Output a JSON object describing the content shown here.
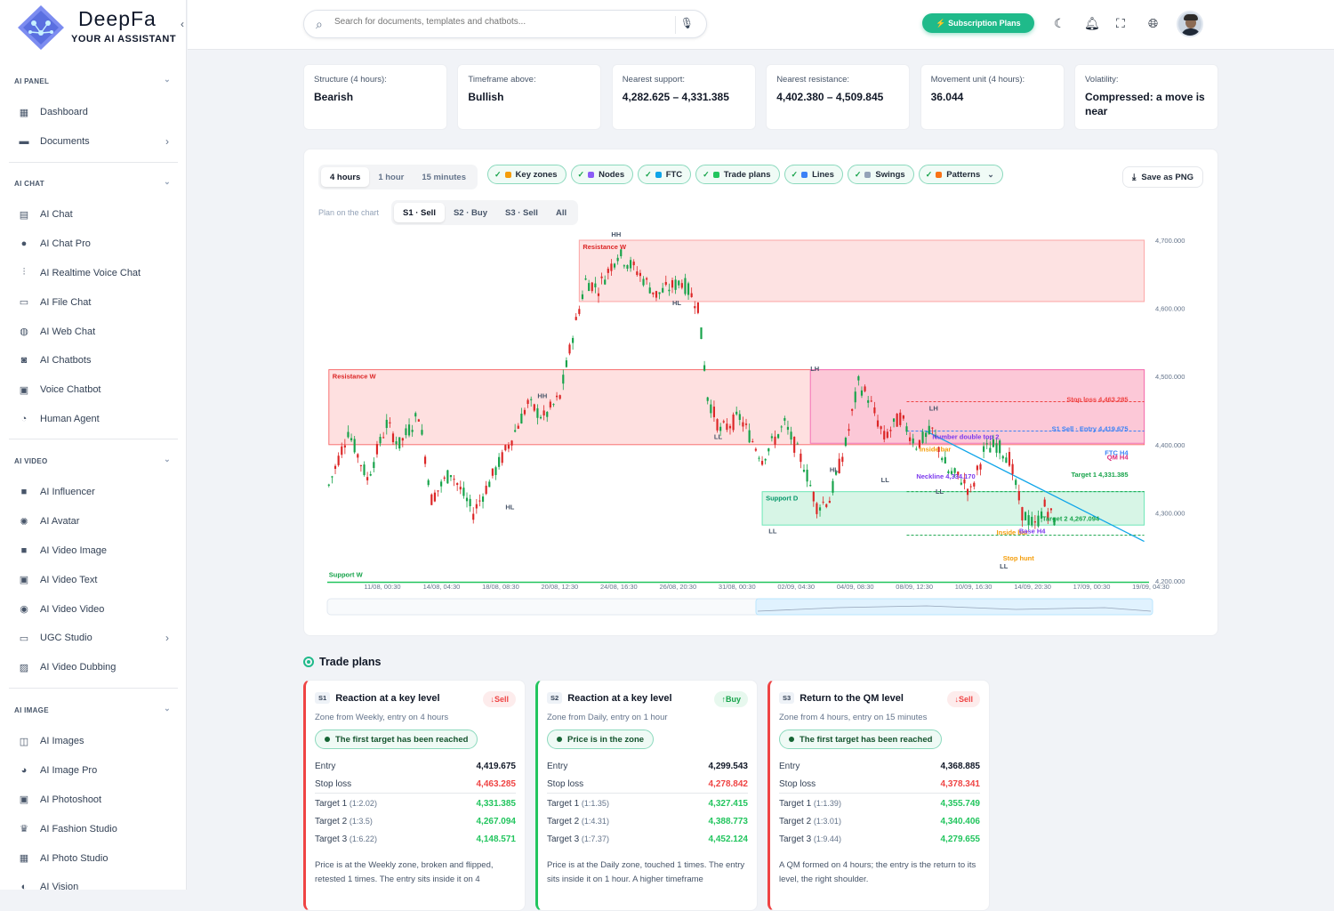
{
  "brand": {
    "name": "DeepFa",
    "tagline": "YOUR AI ASSISTANT"
  },
  "sidebar": {
    "sections": [
      {
        "title": "AI PANEL",
        "items": [
          {
            "label": "Dashboard",
            "icon": "dashboard-icon"
          },
          {
            "label": "Documents",
            "icon": "folder-icon",
            "arrow": true
          }
        ]
      },
      {
        "title": "AI CHAT",
        "items": [
          {
            "label": "AI Chat",
            "icon": "chat-icon"
          },
          {
            "label": "AI Chat Pro",
            "icon": "chat-pro-icon"
          },
          {
            "label": "AI Realtime Voice Chat",
            "icon": "waveform-icon"
          },
          {
            "label": "AI File Chat",
            "icon": "file-chat-icon"
          },
          {
            "label": "AI Web Chat",
            "icon": "globe-icon"
          },
          {
            "label": "AI Chatbots",
            "icon": "robot-icon"
          },
          {
            "label": "Voice Chatbot",
            "icon": "voice-bot-icon"
          },
          {
            "label": "Human Agent",
            "icon": "headset-icon"
          }
        ]
      },
      {
        "title": "AI VIDEO",
        "items": [
          {
            "label": "AI Influencer",
            "icon": "camera-icon"
          },
          {
            "label": "AI Avatar",
            "icon": "avatar-icon"
          },
          {
            "label": "AI Video Image",
            "icon": "video-image-icon"
          },
          {
            "label": "AI Video Text",
            "icon": "video-text-icon"
          },
          {
            "label": "AI Video Video",
            "icon": "video-reel-icon"
          },
          {
            "label": "UGC Studio",
            "icon": "studio-icon",
            "arrow": true
          },
          {
            "label": "AI Video Dubbing",
            "icon": "dubbing-icon"
          }
        ]
      },
      {
        "title": "AI IMAGE",
        "items": [
          {
            "label": "AI Images",
            "icon": "image-scan-icon"
          },
          {
            "label": "AI Image Pro",
            "icon": "image-pro-icon"
          },
          {
            "label": "AI Photoshoot",
            "icon": "photo-icon"
          },
          {
            "label": "AI Fashion Studio",
            "icon": "shirt-icon"
          },
          {
            "label": "AI Photo Studio",
            "icon": "photo-studio-icon"
          },
          {
            "label": "AI Vision",
            "icon": "eye-icon"
          }
        ]
      }
    ]
  },
  "topbar": {
    "search_placeholder": "Search for documents, templates and chatbots...",
    "subscription_label": "⚡ Subscription Plans"
  },
  "stats": [
    {
      "label": "Structure (4 hours):",
      "value": "Bearish"
    },
    {
      "label": "Timeframe above:",
      "value": "Bullish"
    },
    {
      "label": "Nearest support:",
      "value": "4,282.625 – 4,331.385"
    },
    {
      "label": "Nearest resistance:",
      "value": "4,402.380 – 4,509.845"
    },
    {
      "label": "Movement unit (4 hours):",
      "value": "36.044"
    },
    {
      "label": "Volatility:",
      "value": "Compressed: a move is near"
    }
  ],
  "toolbar": {
    "timeframes": [
      "4 hours",
      "1 hour",
      "15 minutes"
    ],
    "active_timeframe": 0,
    "layers": [
      {
        "label": "Key zones",
        "color": "#f59e0b"
      },
      {
        "label": "Nodes",
        "color": "#8b5cf6"
      },
      {
        "label": "FTC",
        "color": "#0ea5e9"
      },
      {
        "label": "Trade plans",
        "color": "#22c55e"
      },
      {
        "label": "Lines",
        "color": "#3b82f6"
      },
      {
        "label": "Swings",
        "color": "#94a3b8"
      },
      {
        "label": "Patterns",
        "color": "#f97316",
        "dropdown": true
      }
    ],
    "save_label": "Save as PNG",
    "plan_label": "Plan on the chart",
    "plans": [
      "S1 · Sell",
      "S2 · Buy",
      "S3 · Sell",
      "All"
    ],
    "active_plan": 0
  },
  "chart_data": {
    "type": "candlestick",
    "y_ticks": [
      "4,700.000",
      "4,600.000",
      "4,500.000",
      "4,400.000",
      "4,300.000",
      "4,200.000"
    ],
    "ylim": [
      4200,
      4700
    ],
    "x_ticks": [
      "11/08, 00:30",
      "14/08, 04:30",
      "18/08, 08:30",
      "20/08, 12:30",
      "24/08, 16:30",
      "26/08, 20:30",
      "31/08, 00:30",
      "02/09, 04:30",
      "04/09, 08:30",
      "08/09, 12:30",
      "10/09, 16:30",
      "14/09, 20:30",
      "17/09, 00:30",
      "19/09, 04:30"
    ],
    "path": [
      [
        0,
        4340
      ],
      [
        6,
        4420
      ],
      [
        12,
        4350
      ],
      [
        18,
        4430
      ],
      [
        22,
        4400
      ],
      [
        28,
        4445
      ],
      [
        32,
        4320
      ],
      [
        38,
        4360
      ],
      [
        45,
        4300
      ],
      [
        55,
        4390
      ],
      [
        62,
        4460
      ],
      [
        67,
        4440
      ],
      [
        72,
        4470
      ],
      [
        76,
        4560
      ],
      [
        80,
        4640
      ],
      [
        84,
        4630
      ],
      [
        90,
        4680
      ],
      [
        96,
        4655
      ],
      [
        102,
        4620
      ],
      [
        110,
        4640
      ],
      [
        115,
        4605
      ],
      [
        118,
        4470
      ],
      [
        122,
        4420
      ],
      [
        128,
        4440
      ],
      [
        135,
        4380
      ],
      [
        142,
        4430
      ],
      [
        148,
        4370
      ],
      [
        152,
        4310
      ],
      [
        156,
        4320
      ],
      [
        161,
        4400
      ],
      [
        165,
        4490
      ],
      [
        168,
        4470
      ],
      [
        173,
        4410
      ],
      [
        178,
        4440
      ],
      [
        183,
        4400
      ],
      [
        188,
        4420
      ],
      [
        193,
        4360
      ],
      [
        197,
        4350
      ],
      [
        200,
        4330
      ],
      [
        204,
        4390
      ],
      [
        208,
        4400
      ],
      [
        212,
        4380
      ],
      [
        216,
        4300
      ],
      [
        220,
        4280
      ],
      [
        223,
        4310
      ],
      [
        226,
        4290
      ]
    ],
    "zones": [
      {
        "label": "Resistance W",
        "y1": 4610,
        "y2": 4700,
        "x1": 78,
        "x2": 254,
        "fill": "#fde2e2",
        "stroke": "#fca5a5",
        "color": "#dc2626"
      },
      {
        "label": "Resistance W",
        "y1": 4400,
        "y2": 4510,
        "x1": 0,
        "x2": 254,
        "fill": "rgba(252,180,180,.42)",
        "stroke": "#f87171",
        "color": "#dc2626"
      },
      {
        "label": "Support D",
        "y1": 4282,
        "y2": 4331,
        "x1": 135,
        "x2": 254,
        "fill": "rgba(167,232,200,.45)",
        "stroke": "#6ee7b7",
        "color": "#059669"
      },
      {
        "label": "",
        "y1": 4402,
        "y2": 4510,
        "x1": 150,
        "x2": 254,
        "fill": "rgba(244,114,182,.22)",
        "stroke": "#f472b6",
        "color": "#db2777"
      }
    ],
    "annotations": [
      {
        "text": "HH",
        "x": 88,
        "y": 4705,
        "color": "#475569"
      },
      {
        "text": "HH",
        "x": 65,
        "y": 4468,
        "color": "#475569"
      },
      {
        "text": "HL",
        "x": 55,
        "y": 4305,
        "color": "#475569"
      },
      {
        "text": "HL",
        "x": 107,
        "y": 4605,
        "color": "#475569"
      },
      {
        "text": "LL",
        "x": 120,
        "y": 4408,
        "color": "#475569"
      },
      {
        "text": "LL",
        "x": 137,
        "y": 4270,
        "color": "#475569"
      },
      {
        "text": "LH",
        "x": 150,
        "y": 4508,
        "color": "#475569"
      },
      {
        "text": "HL",
        "x": 156,
        "y": 4360,
        "color": "#475569"
      },
      {
        "text": "LL",
        "x": 172,
        "y": 4345,
        "color": "#475569"
      },
      {
        "text": "LH",
        "x": 187,
        "y": 4450,
        "color": "#475569"
      },
      {
        "text": "LL",
        "x": 189,
        "y": 4328,
        "color": "#475569"
      },
      {
        "text": "LL",
        "x": 209,
        "y": 4218,
        "color": "#475569"
      },
      {
        "text": "Stop loss  4,463.285",
        "x": 249,
        "y": 4463,
        "color": "#ef4444",
        "anchor": "end"
      },
      {
        "text": "S1 Sell · Entry  4,419.675",
        "x": 249,
        "y": 4420,
        "color": "#3b82f6",
        "anchor": "end"
      },
      {
        "text": "FTC H4",
        "x": 249,
        "y": 4385,
        "color": "#3b82f6",
        "anchor": "end"
      },
      {
        "text": "QM H4",
        "x": 249,
        "y": 4378,
        "color": "#db2777",
        "anchor": "end"
      },
      {
        "text": "Target 1  4,331.385",
        "x": 249,
        "y": 4353,
        "color": "#16a34a",
        "anchor": "end"
      },
      {
        "text": "Target 2  4,267.094",
        "x": 240,
        "y": 4288,
        "color": "#16a34a",
        "anchor": "end"
      },
      {
        "text": "Number double top 2",
        "x": 188,
        "y": 4408,
        "color": "#7c3aed"
      },
      {
        "text": "Neckline 4,334.170",
        "x": 183,
        "y": 4350,
        "color": "#7c3aed"
      },
      {
        "text": "Inside bar",
        "x": 184,
        "y": 4390,
        "color": "#f59e0b"
      },
      {
        "text": "Inside bar",
        "x": 208,
        "y": 4268,
        "color": "#f59e0b"
      },
      {
        "text": "Base H4",
        "x": 215,
        "y": 4270,
        "color": "#7c3aed"
      },
      {
        "text": "Stop hunt",
        "x": 210,
        "y": 4230,
        "color": "#f59e0b"
      },
      {
        "text": "Support W",
        "x": 0,
        "y": 4206,
        "color": "#16a34a"
      }
    ]
  },
  "trade_plans": {
    "title": "Trade plans",
    "plans": [
      {
        "tag": "S1",
        "title": "Reaction at a key level",
        "side": "Sell",
        "side_type": "sell",
        "subtitle": "Zone from Weekly, entry on 4 hours",
        "status": "The first target has been reached",
        "entry": "4,419.675",
        "stop_loss": "4,463.285",
        "targets": [
          {
            "label": "Target 1",
            "ratio": "(1:2.02)",
            "value": "4,331.385"
          },
          {
            "label": "Target 2",
            "ratio": "(1:3.5)",
            "value": "4,267.094"
          },
          {
            "label": "Target 3",
            "ratio": "(1:6.22)",
            "value": "4,148.571"
          }
        ],
        "description": "Price is at the Weekly zone, broken and flipped, retested 1 times. The entry sits inside it on 4"
      },
      {
        "tag": "S2",
        "title": "Reaction at a key level",
        "side": "Buy",
        "side_type": "buy",
        "subtitle": "Zone from Daily, entry on 1 hour",
        "status": "Price is in the zone",
        "entry": "4,299.543",
        "stop_loss": "4,278.842",
        "targets": [
          {
            "label": "Target 1",
            "ratio": "(1:1.35)",
            "value": "4,327.415"
          },
          {
            "label": "Target 2",
            "ratio": "(1:4.31)",
            "value": "4,388.773"
          },
          {
            "label": "Target 3",
            "ratio": "(1:7.37)",
            "value": "4,452.124"
          }
        ],
        "description": "Price is at the Daily zone, touched 1 times. The entry sits inside it on 1 hour. A higher timeframe"
      },
      {
        "tag": "S3",
        "title": "Return to the QM level",
        "side": "Sell",
        "side_type": "sell",
        "subtitle": "Zone from 4 hours, entry on 15 minutes",
        "status": "The first target has been reached",
        "entry": "4,368.885",
        "stop_loss": "4,378.341",
        "targets": [
          {
            "label": "Target 1",
            "ratio": "(1:1.39)",
            "value": "4,355.749"
          },
          {
            "label": "Target 2",
            "ratio": "(1:3.01)",
            "value": "4,340.406"
          },
          {
            "label": "Target 3",
            "ratio": "(1:9.44)",
            "value": "4,279.655"
          }
        ],
        "description": "A QM formed on 4 hours; the entry is the return to its level, the right shoulder."
      }
    ]
  },
  "labels": {
    "entry": "Entry",
    "stop_loss": "Stop loss"
  }
}
